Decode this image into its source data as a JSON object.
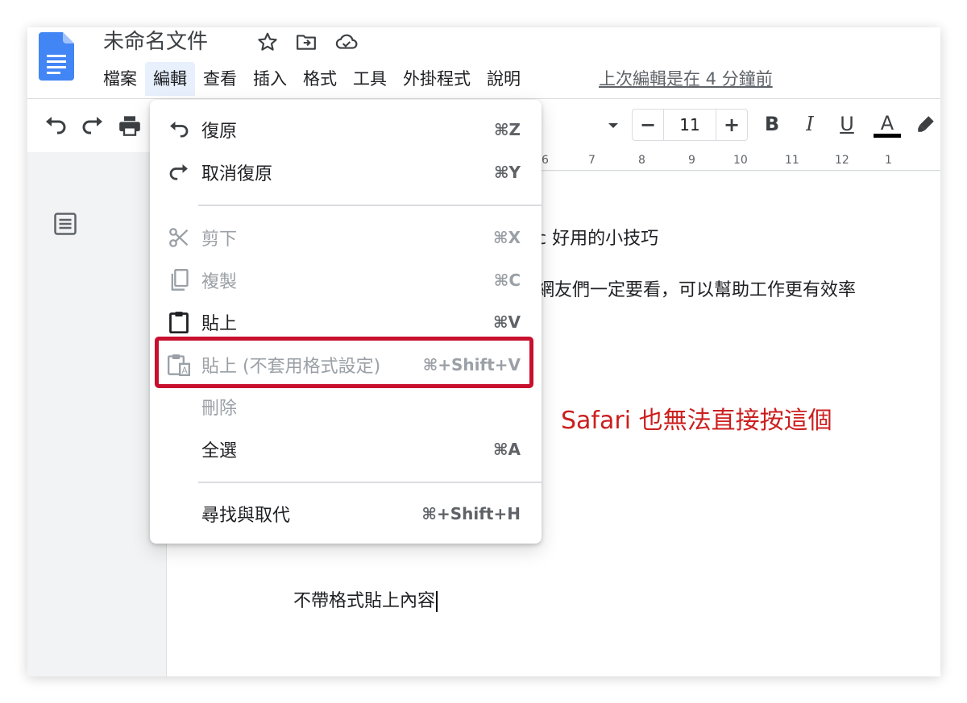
{
  "header": {
    "doc_title": "未命名文件",
    "last_edit": "上次編輯是在 4 分鐘前"
  },
  "menubar": [
    {
      "label": "檔案"
    },
    {
      "label": "編輯"
    },
    {
      "label": "查看"
    },
    {
      "label": "插入"
    },
    {
      "label": "格式"
    },
    {
      "label": "工具"
    },
    {
      "label": "外掛程式"
    },
    {
      "label": "說明"
    }
  ],
  "toolbar": {
    "font_size": "11",
    "minus_label": "−",
    "plus_label": "+",
    "bold_label": "B",
    "italic_label": "I",
    "underline_label": "U",
    "textcolor_label": "A"
  },
  "ruler_marks": [
    "6",
    "7",
    "8",
    "9",
    "10",
    "11",
    "12",
    "1"
  ],
  "edit_menu": {
    "undo": {
      "label": "復原",
      "shortcut": "⌘Z"
    },
    "redo": {
      "label": "取消復原",
      "shortcut": "⌘Y"
    },
    "cut": {
      "label": "剪下",
      "shortcut": "⌘X"
    },
    "copy": {
      "label": "複製",
      "shortcut": "⌘C"
    },
    "paste": {
      "label": "貼上",
      "shortcut": "⌘V"
    },
    "paste_plain": {
      "label": "貼上 (不套用格式設定)",
      "shortcut": "⌘+Shift+V"
    },
    "delete": {
      "label": "刪除"
    },
    "select_all": {
      "label": "全選",
      "shortcut": "⌘A"
    },
    "find_replace": {
      "label": "尋找與取代",
      "shortcut": "⌘+Shift+H"
    }
  },
  "document": {
    "line1": "c 好用的小技巧",
    "line2": "網友們一定要看，可以幫助工作更有效率",
    "line3": "不帶格式貼上內容"
  },
  "annotation": "Safari 也無法直接按這個",
  "colors": {
    "docs_blue": "#4285f4",
    "annotation_red": "#cc1f1f",
    "highlight_border": "#c8102e",
    "menu_active_bg": "#e8f0fe"
  }
}
